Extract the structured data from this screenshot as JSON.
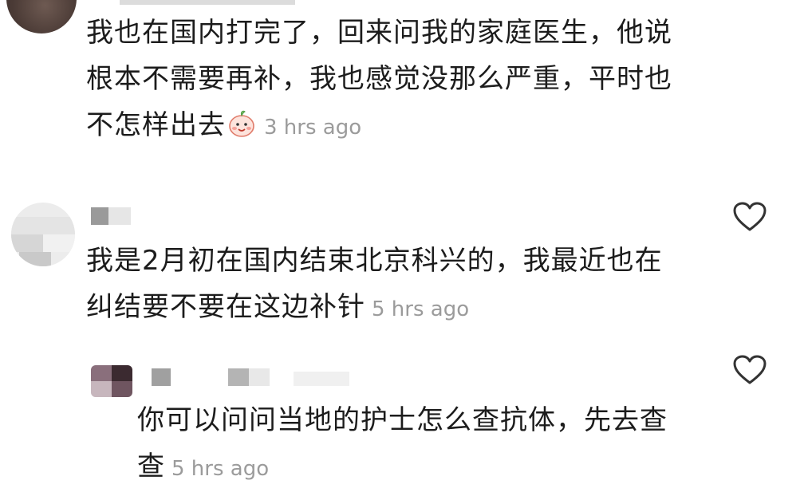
{
  "comments": [
    {
      "text_lines": [
        "我也在国内打完了，回来问我的家庭医生，他说",
        "根本不需要再补，我也感觉没那么严重，平时也",
        "不怎样出去"
      ],
      "emoji": "smiling-peach-emoji",
      "time": "3 hrs ago"
    },
    {
      "text_lines": [
        "我是2月初在国内结束北京科兴的，我最近也在",
        "纠结要不要在这边补针"
      ],
      "time": "5 hrs ago",
      "liked": false
    },
    {
      "text_lines": [
        "你可以问问当地的护士怎么查抗体，先去查",
        "查"
      ],
      "time": "5 hrs ago",
      "liked": false
    }
  ],
  "icons": {
    "like": "heart-outline-icon"
  },
  "colors": {
    "text": "#1c1c1c",
    "timestamp": "#9b9b9b",
    "icon": "#333333"
  }
}
